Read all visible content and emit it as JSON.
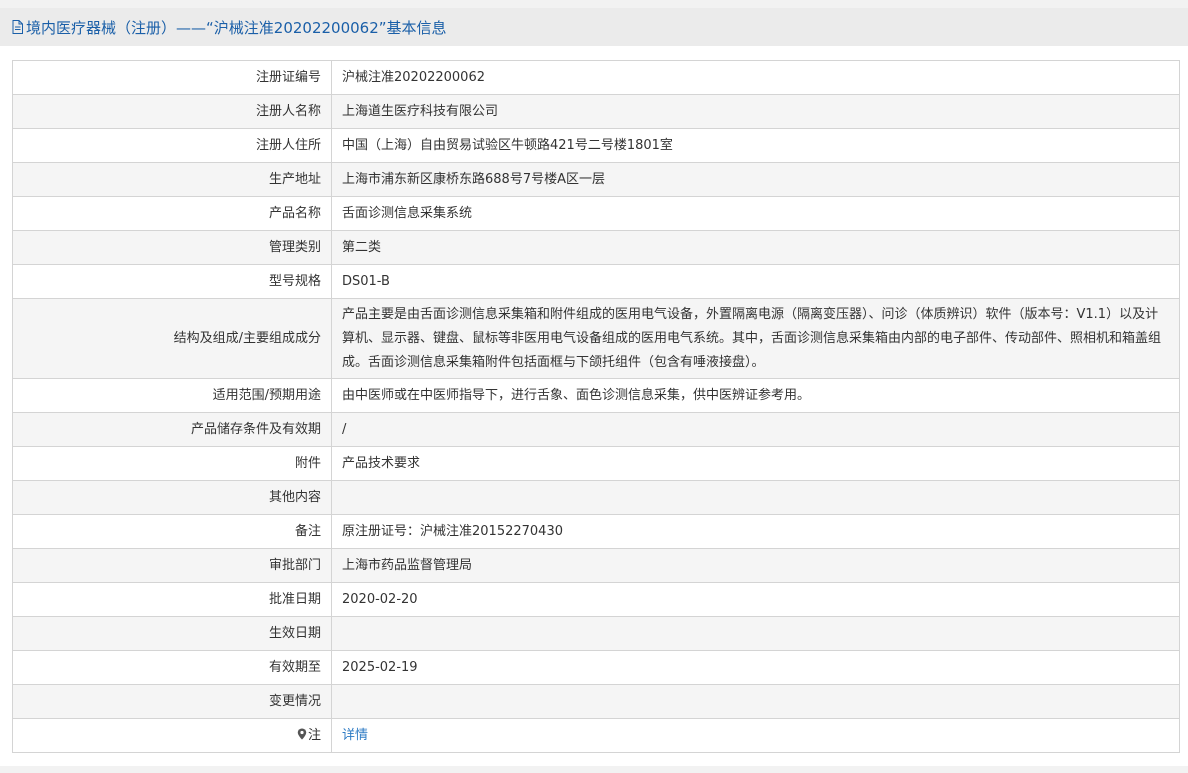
{
  "page": {
    "title": "境内医疗器械（注册）——“沪械注准20202200062”基本信息",
    "title_icon": "document-icon"
  },
  "rows": [
    {
      "label": "注册证编号",
      "value": "沪械注准20202200062"
    },
    {
      "label": "注册人名称",
      "value": "上海道生医疗科技有限公司"
    },
    {
      "label": "注册人住所",
      "value": "中国（上海）自由贸易试验区牛顿路421号二号楼1801室"
    },
    {
      "label": "生产地址",
      "value": "上海市浦东新区康桥东路688号7号楼A区一层"
    },
    {
      "label": "产品名称",
      "value": "舌面诊测信息采集系统"
    },
    {
      "label": "管理类别",
      "value": "第二类"
    },
    {
      "label": "型号规格",
      "value": "DS01-B"
    },
    {
      "label": "结构及组成/主要组成成分",
      "value": "产品主要是由舌面诊测信息采集箱和附件组成的医用电气设备，外置隔离电源（隔离变压器）、问诊（体质辨识）软件（版本号：V1.1）以及计算机、显示器、键盘、鼠标等非医用电气设备组成的医用电气系统。其中，舌面诊测信息采集箱由内部的电子部件、传动部件、照相机和箱盖组成。舌面诊测信息采集箱附件包括面框与下颌托组件（包含有唾液接盘）。"
    },
    {
      "label": "适用范围/预期用途",
      "value": "由中医师或在中医师指导下，进行舌象、面色诊测信息采集，供中医辨证参考用。"
    },
    {
      "label": "产品储存条件及有效期",
      "value": "/"
    },
    {
      "label": "附件",
      "value": "产品技术要求"
    },
    {
      "label": "其他内容",
      "value": ""
    },
    {
      "label": "备注",
      "value": "原注册证号：沪械注准20152270430"
    },
    {
      "label": "审批部门",
      "value": "上海市药品监督管理局"
    },
    {
      "label": "批准日期",
      "value": "2020-02-20"
    },
    {
      "label": "生效日期",
      "value": ""
    },
    {
      "label": "有效期至",
      "value": "2025-02-19"
    },
    {
      "label": "变更情况",
      "value": ""
    }
  ],
  "note_row": {
    "label": "注",
    "icon": "location-pin-icon",
    "link_text": "详情"
  },
  "colors": {
    "title_text": "#1a5fa8",
    "link": "#2d7bc4",
    "border": "#d4d4d4",
    "alt_row_bg": "#f5f5f5",
    "title_bar_bg": "#ebebeb"
  }
}
